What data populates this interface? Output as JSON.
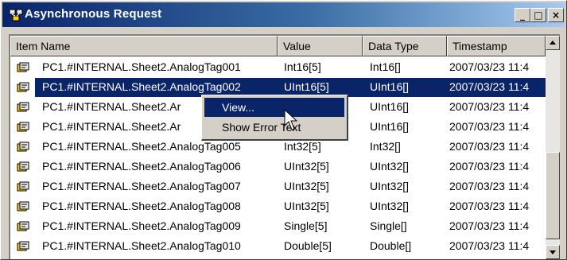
{
  "window": {
    "title": "Asynchronous Request",
    "controls": [
      "_",
      "□",
      "×"
    ]
  },
  "listview": {
    "columns": [
      "Item Name",
      "Value",
      "Data Type",
      "Timestamp"
    ],
    "rows": [
      {
        "name": "PC1.#INTERNAL.Sheet2.AnalogTag001",
        "value": "Int16[5]",
        "type": "Int16[]",
        "time": "2007/03/23 11:4"
      },
      {
        "name": "PC1.#INTERNAL.Sheet2.AnalogTag002",
        "value": "UInt16[5]",
        "type": "UInt16[]",
        "time": "2007/03/23 11:4",
        "selected": true
      },
      {
        "name": "PC1.#INTERNAL.Sheet2.Ar",
        "value": "",
        "type": "UInt16[]",
        "time": "2007/03/23 11:4"
      },
      {
        "name": "PC1.#INTERNAL.Sheet2.Ar",
        "value": "",
        "type": "UInt16[]",
        "time": "2007/03/23 11:4"
      },
      {
        "name": "PC1.#INTERNAL.Sheet2.AnalogTag005",
        "value": "Int32[5]",
        "type": "Int32[]",
        "time": "2007/03/23 11:4"
      },
      {
        "name": "PC1.#INTERNAL.Sheet2.AnalogTag006",
        "value": "UInt32[5]",
        "type": "UInt32[]",
        "time": "2007/03/23 11:4"
      },
      {
        "name": "PC1.#INTERNAL.Sheet2.AnalogTag007",
        "value": "UInt32[5]",
        "type": "UInt32[]",
        "time": "2007/03/23 11:4"
      },
      {
        "name": "PC1.#INTERNAL.Sheet2.AnalogTag008",
        "value": "UInt32[5]",
        "type": "UInt32[]",
        "time": "2007/03/23 11:4"
      },
      {
        "name": "PC1.#INTERNAL.Sheet2.AnalogTag009",
        "value": "Single[5]",
        "type": "Single[]",
        "time": "2007/03/23 11:4"
      },
      {
        "name": "PC1.#INTERNAL.Sheet2.AnalogTag010",
        "value": "Double[5]",
        "type": "Double[]",
        "time": "2007/03/23 11:4"
      }
    ]
  },
  "context_menu": {
    "items": [
      "View...",
      "Show Error Text"
    ],
    "highlighted_index": 0
  },
  "colors": {
    "selection": "#0a246a",
    "title_gradient_start": "#0a246a",
    "title_gradient_end": "#a6caf0",
    "face": "#d4d0c8"
  },
  "icons": {
    "app": "network-app-icon",
    "row": "tag-item-icon",
    "cursor": "mouse-pointer-icon"
  }
}
